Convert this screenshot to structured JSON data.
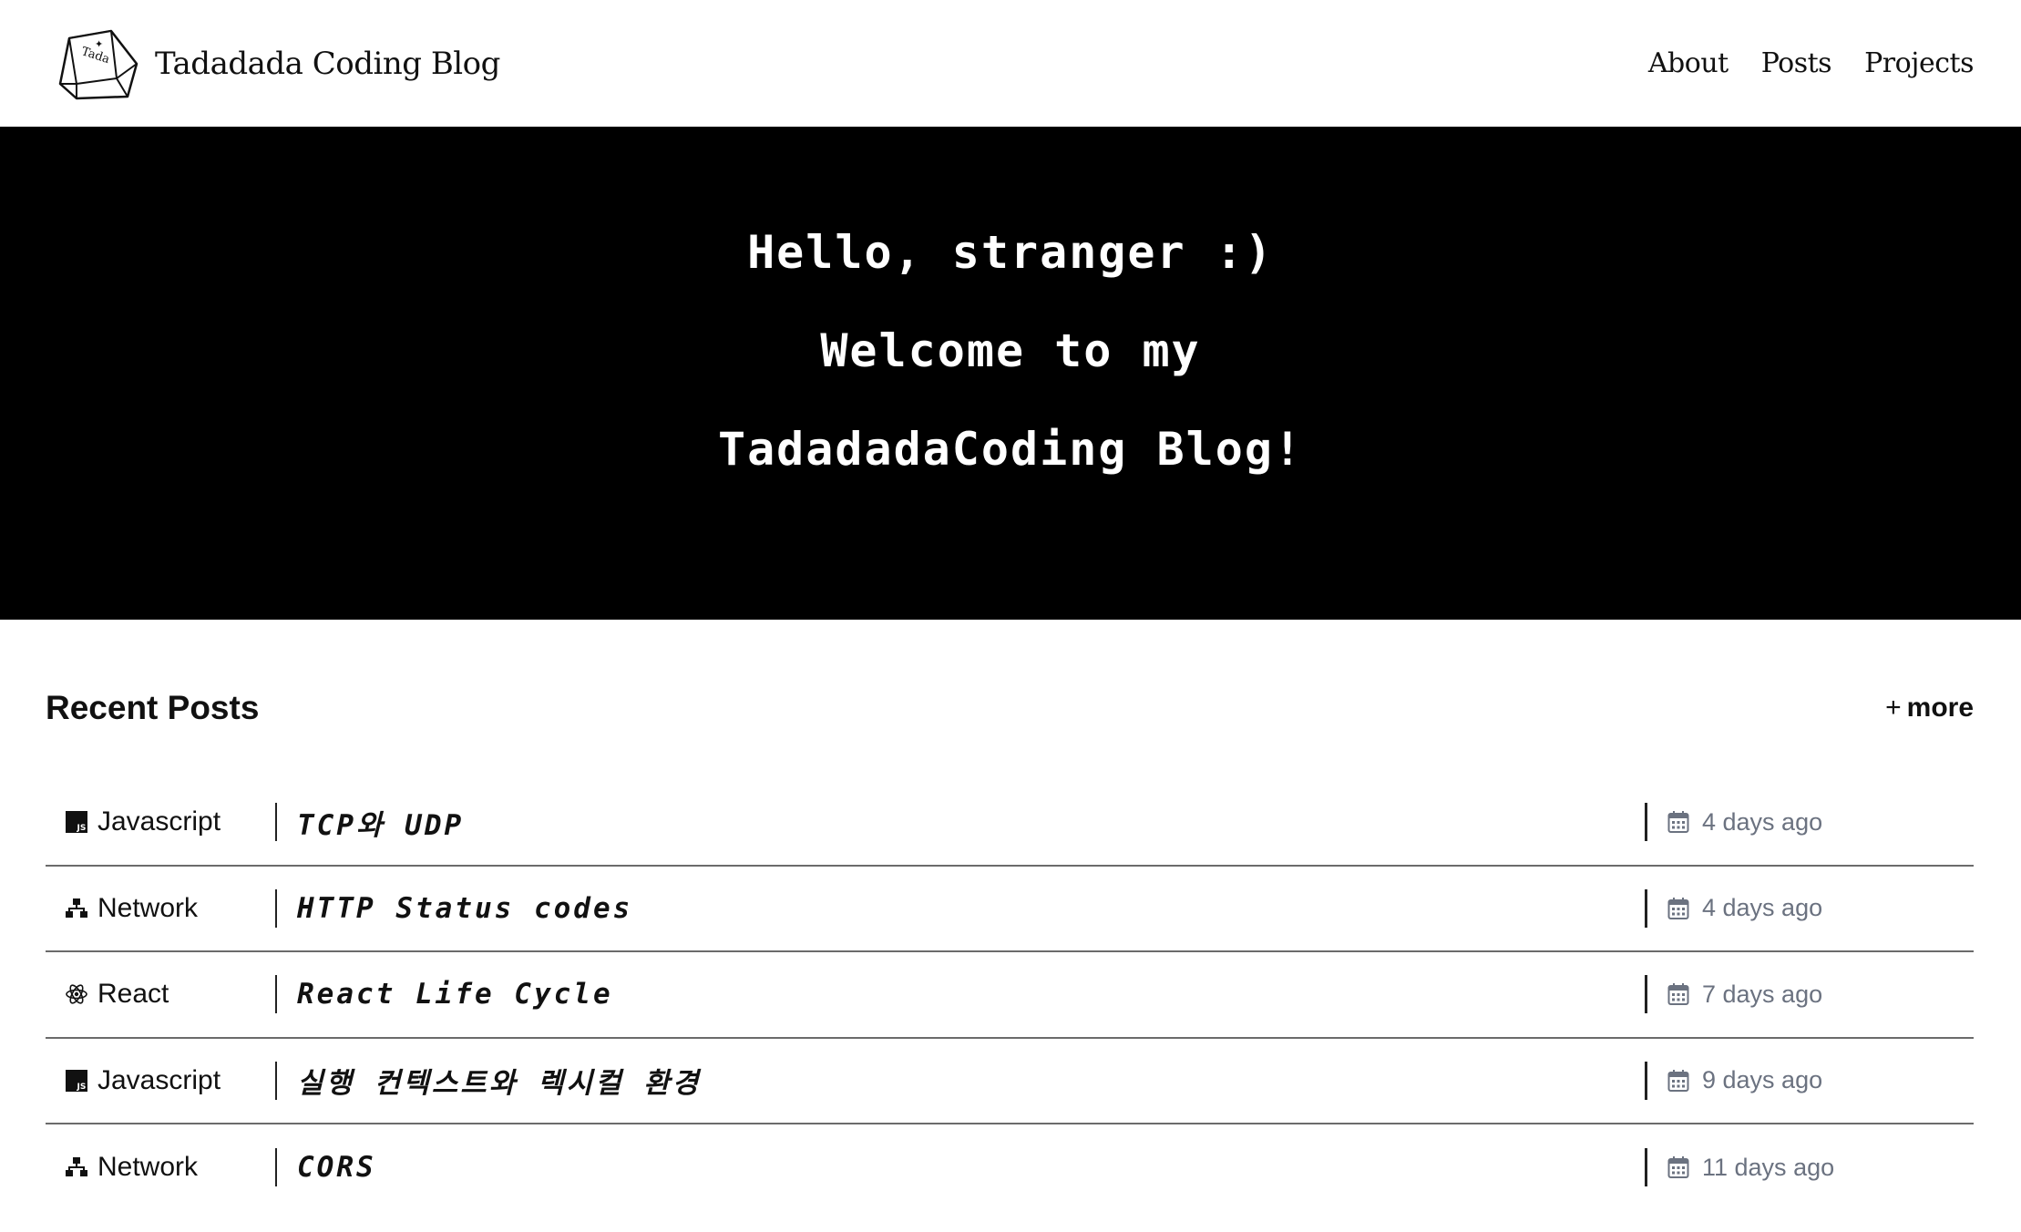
{
  "header": {
    "logo_text": "Tada",
    "brand_name": "Tadadada Coding Blog",
    "nav": [
      "About",
      "Posts",
      "Projects"
    ]
  },
  "hero": {
    "lines": [
      "Hello, stranger :)",
      "Welcome to my",
      "TadadadaCoding Blog!"
    ]
  },
  "recent": {
    "title": "Recent Posts",
    "more_label": "more",
    "more_prefix": "+",
    "posts": [
      {
        "category": "Javascript",
        "icon": "javascript-icon",
        "title": "TCP와 UDP",
        "date": "4 days ago"
      },
      {
        "category": "Network",
        "icon": "network-icon",
        "title": "HTTP Status codes",
        "date": "4 days ago"
      },
      {
        "category": "React",
        "icon": "react-icon",
        "title": "React Life Cycle",
        "date": "7 days ago"
      },
      {
        "category": "Javascript",
        "icon": "javascript-icon",
        "title": "실행 컨텍스트와 렉시컬 환경",
        "date": "9 days ago"
      },
      {
        "category": "Network",
        "icon": "network-icon",
        "title": "CORS",
        "date": "11 days ago"
      }
    ]
  },
  "colors": {
    "hero_bg": "#000000",
    "date_text": "#6b7280",
    "divider": "#6b6b6b"
  }
}
